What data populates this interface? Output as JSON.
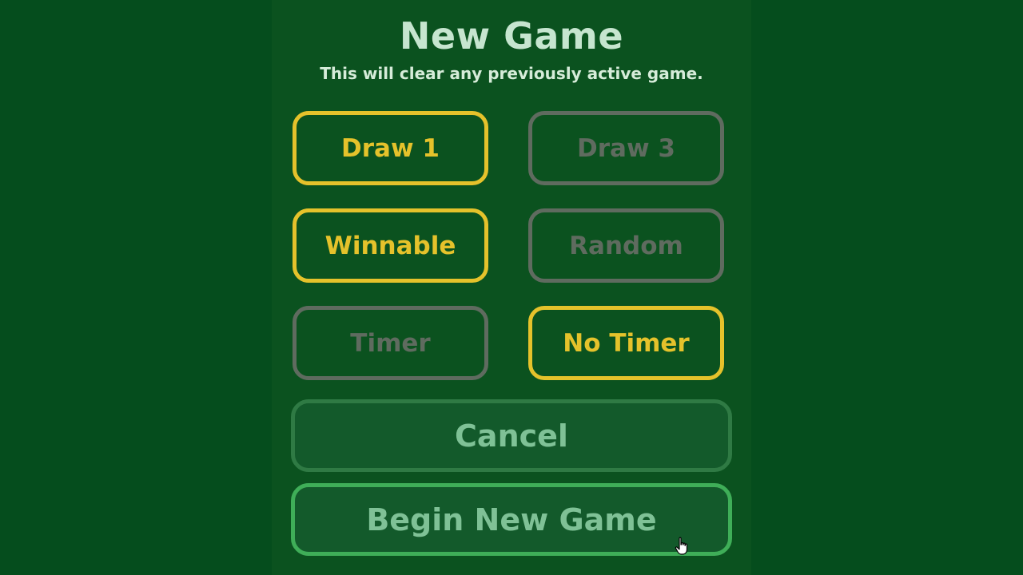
{
  "dialog": {
    "title": "New Game",
    "subtitle": "This will clear any previously active game."
  },
  "options": [
    {
      "label": "Draw 1",
      "selected": true
    },
    {
      "label": "Draw 3",
      "selected": false
    },
    {
      "label": "Winnable",
      "selected": true
    },
    {
      "label": "Random",
      "selected": false
    },
    {
      "label": "Timer",
      "selected": false
    },
    {
      "label": "No Timer",
      "selected": true
    }
  ],
  "actions": {
    "cancel_label": "Cancel",
    "begin_label": "Begin New Game"
  },
  "colors": {
    "background": "#054d1d",
    "panel": "#0b521f",
    "selected": "#e5c22b",
    "unselected": "#5f6b5f",
    "cancel_border": "#2f7a44",
    "begin_border": "#3fae58"
  },
  "icons": {
    "cursor": "hand-pointer-icon"
  }
}
